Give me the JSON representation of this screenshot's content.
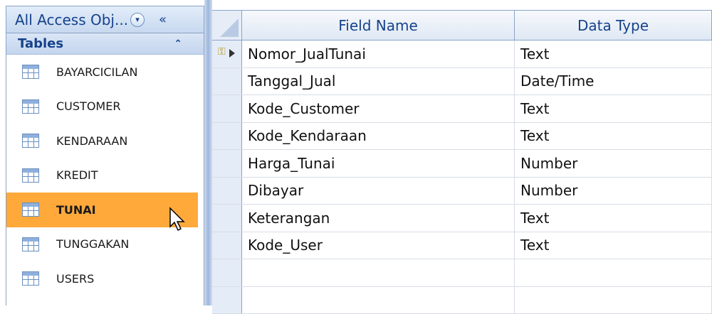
{
  "nav": {
    "title": "All Access Obj...",
    "dropdown_glyph": "▾",
    "collapse_glyph": "«",
    "group_label": "Tables",
    "group_chevron": "⌃",
    "items": [
      {
        "label": "BAYARCICILAN",
        "icon": "table-icon"
      },
      {
        "label": "CUSTOMER",
        "icon": "table-icon"
      },
      {
        "label": "KENDARAAN",
        "icon": "table-icon"
      },
      {
        "label": "KREDIT",
        "icon": "table-icon"
      },
      {
        "label": "TUNAI",
        "icon": "table-icon",
        "selected": true
      },
      {
        "label": "TUNGGAKAN",
        "icon": "table-icon"
      },
      {
        "label": "USERS",
        "icon": "table-icon"
      }
    ]
  },
  "grid": {
    "headers": {
      "field_name": "Field Name",
      "data_type": "Data Type"
    },
    "rows": [
      {
        "field": "Nomor_JualTunai",
        "type": "Text",
        "primary_key": true
      },
      {
        "field": "Tanggal_Jual",
        "type": "Date/Time"
      },
      {
        "field": "Kode_Customer",
        "type": "Text"
      },
      {
        "field": "Kode_Kendaraan",
        "type": "Text"
      },
      {
        "field": "Harga_Tunai",
        "type": "Number"
      },
      {
        "field": "Dibayar",
        "type": "Number"
      },
      {
        "field": "Keterangan",
        "type": "Text"
      },
      {
        "field": "Kode_User",
        "type": "Text"
      },
      {
        "field": "",
        "type": ""
      },
      {
        "field": "",
        "type": ""
      }
    ]
  },
  "colors": {
    "selection": "#ffa93b",
    "header_text": "#15428b"
  }
}
